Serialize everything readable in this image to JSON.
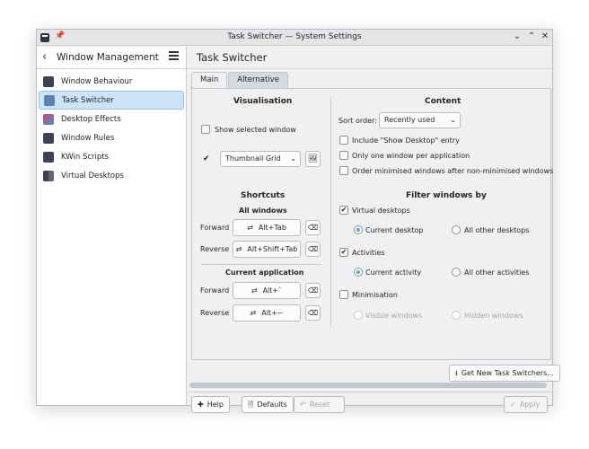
{
  "window": {
    "title": "Task Switcher — System Settings",
    "buttons": {
      "minimize": "⌄",
      "maximize": "⌃",
      "close": "✕"
    }
  },
  "sidebar": {
    "header": "Window Management",
    "items": [
      {
        "label": "Window Behaviour",
        "icon": "window-behaviour-icon",
        "color": "#3b4252"
      },
      {
        "label": "Task Switcher",
        "icon": "task-switcher-icon",
        "color": "#5e81ac"
      },
      {
        "label": "Desktop Effects",
        "icon": "desktop-effects-icon",
        "color": "#d0436f"
      },
      {
        "label": "Window Rules",
        "icon": "window-rules-icon",
        "color": "#3b4252"
      },
      {
        "label": "KWin Scripts",
        "icon": "kwin-scripts-icon",
        "color": "#3b4252"
      },
      {
        "label": "Virtual Desktops",
        "icon": "virtual-desktops-icon",
        "color": "#3b4252"
      }
    ]
  },
  "main": {
    "title": "Task Switcher",
    "tabs": [
      "Main",
      "Alternative"
    ],
    "visualisation": {
      "title": "Visualisation",
      "show_selected_window": "Show selected window",
      "style_value": "Thumbnail Grid"
    },
    "shortcuts": {
      "title": "Shortcuts",
      "all_windows": "All windows",
      "current_application": "Current application",
      "forward": "Forward",
      "reverse": "Reverse",
      "all_forward_key": "Alt+Tab",
      "all_reverse_key": "Alt+Shift+Tab",
      "app_forward_key": "Alt+`",
      "app_reverse_key": "Alt+~"
    },
    "content": {
      "title": "Content",
      "sort_order_label": "Sort order:",
      "sort_order_value": "Recently used",
      "include_show_desktop": "Include \"Show Desktop\" entry",
      "only_one_window": "Only one window per application",
      "order_minimised": "Order minimised windows after non-minimised windows"
    },
    "filter": {
      "title": "Filter windows by",
      "virtual_desktops": "Virtual desktops",
      "current_desktop": "Current desktop",
      "all_other_desktops": "All other desktops",
      "activities": "Activities",
      "current_activity": "Current activity",
      "all_other_activities": "All other activities",
      "minimisation": "Minimisation",
      "visible_windows": "Visible windows",
      "hidden_windows": "Hidden windows"
    },
    "get_new": "Get New Task Switchers...",
    "footer": {
      "help": "Help",
      "defaults": "Defaults",
      "reset": "Reset",
      "apply": "Apply"
    }
  }
}
